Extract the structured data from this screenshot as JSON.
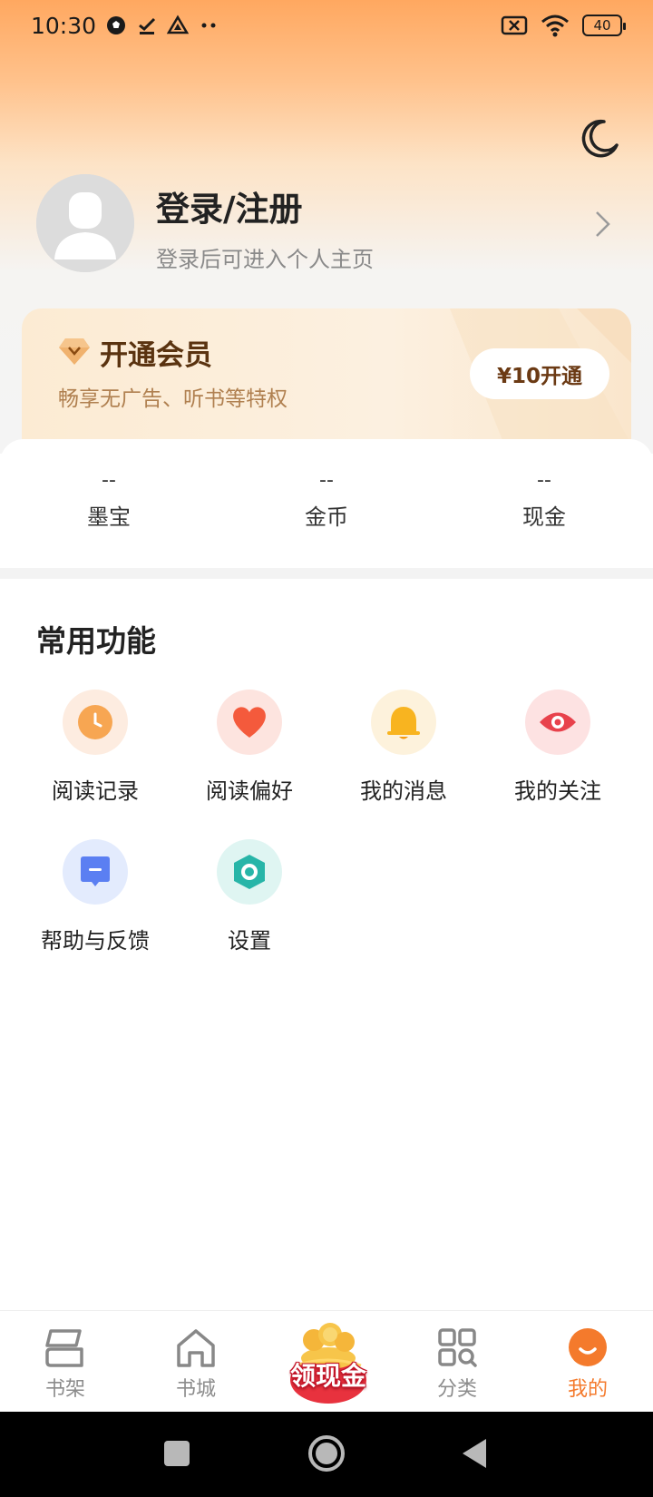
{
  "status_bar": {
    "time": "10:30",
    "battery": "40",
    "icons": [
      "soccer-icon",
      "download-done-icon",
      "drive-icon",
      "more-dots-icon",
      "sim-off-icon",
      "wifi-icon",
      "battery-icon"
    ]
  },
  "header": {
    "theme_toggle_icon": "moon-icon"
  },
  "profile": {
    "title": "登录/注册",
    "subtitle": "登录后可进入个人主页"
  },
  "vip": {
    "title": "开通会员",
    "subtitle": "畅享无广告、听书等特权",
    "button_label": "¥10开通"
  },
  "stats": [
    {
      "value": "--",
      "label": "墨宝"
    },
    {
      "value": "--",
      "label": "金币"
    },
    {
      "value": "--",
      "label": "现金"
    }
  ],
  "functions": {
    "title": "常用功能",
    "items": [
      {
        "label": "阅读记录",
        "icon": "clock-icon"
      },
      {
        "label": "阅读偏好",
        "icon": "heart-icon"
      },
      {
        "label": "我的消息",
        "icon": "bell-icon"
      },
      {
        "label": "我的关注",
        "icon": "eye-icon"
      },
      {
        "label": "帮助与反馈",
        "icon": "chat-bubble-icon"
      },
      {
        "label": "设置",
        "icon": "settings-hexagon-icon"
      }
    ]
  },
  "bottom_nav": {
    "items": [
      {
        "label": "书架",
        "icon": "bookshelf-icon",
        "active": false
      },
      {
        "label": "书城",
        "icon": "home-icon",
        "active": false
      },
      {
        "label": "分类",
        "icon": "category-grid-icon",
        "active": false
      },
      {
        "label": "我的",
        "icon": "profile-icon",
        "active": true
      }
    ],
    "promo_label": "领现金"
  },
  "colors": {
    "accent": "#f47a2c",
    "vip_text": "#5a3310",
    "header_gradient_top": "#ffa860"
  }
}
